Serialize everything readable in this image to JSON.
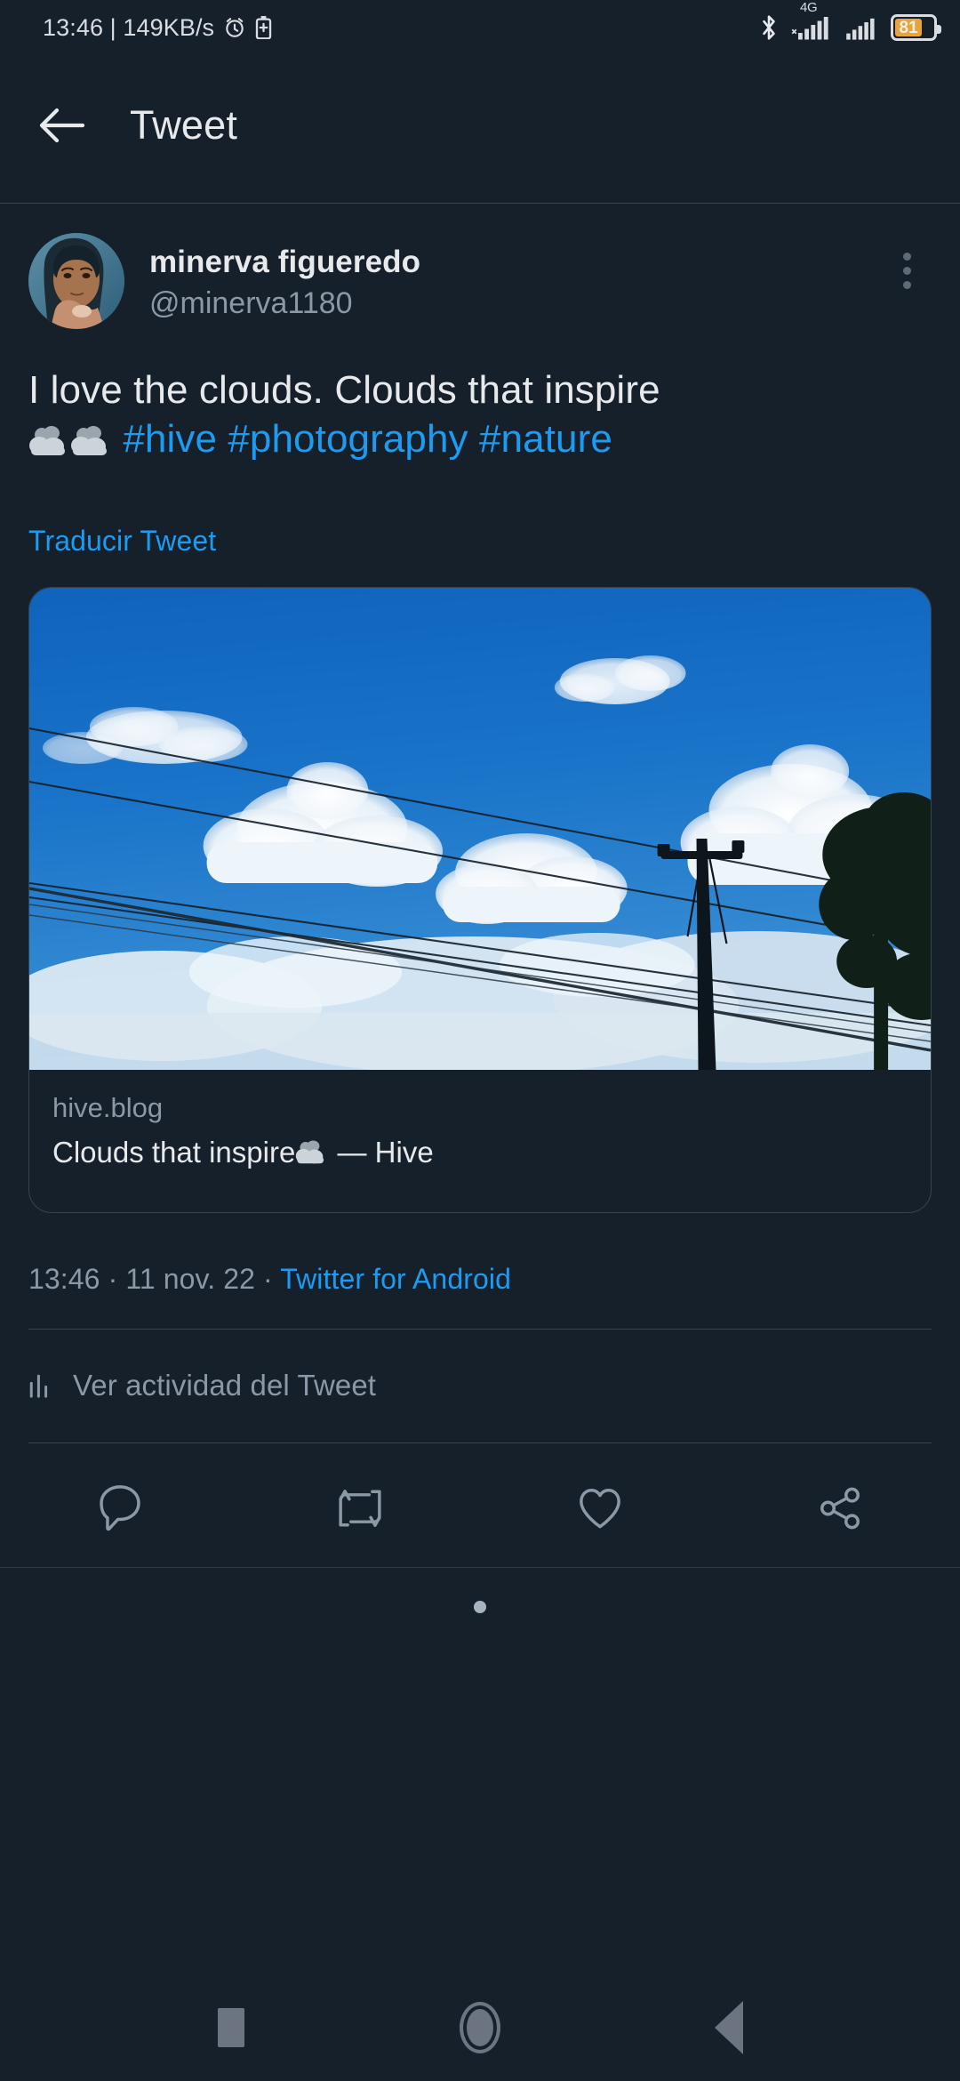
{
  "status_bar": {
    "clock_and_speed": "13:46 | 149KB/s",
    "alarm_icon": "alarm-clock-icon",
    "mini_battery_icon": "battery-saver-icon",
    "bluetooth_icon": "bluetooth-icon",
    "network_type": "4G",
    "signal_icon_1": "cellular-signal-icon",
    "signal_icon_2": "cellular-signal-icon",
    "battery_percent": "81",
    "battery_fill_color": "#e8a33d"
  },
  "header": {
    "back_icon": "back-arrow-icon",
    "title": "Tweet"
  },
  "tweet": {
    "avatar_icon": "user-avatar-image",
    "author_name": "minerva figueredo",
    "author_handle": "@minerva1180",
    "more_icon": "more-vertical-icon",
    "body_line1": "I love the clouds. Clouds that inspire",
    "cloud_emoji": "cloud-emoji",
    "hashtags": "#hive #photography #nature",
    "translate_label": "Traducir Tweet",
    "timestamp": "13:46 · 11 nov. 22 · ",
    "source_label": "Twitter for Android",
    "activity_icon": "bar-chart-icon",
    "activity_label": "Ver actividad del Tweet"
  },
  "link_card": {
    "photo_alt": "blue-sky-with-clouds-and-power-lines-photo",
    "domain": "hive.blog",
    "title_before": "Clouds that inspire",
    "title_emoji": "cloud-emoji",
    "title_after": " — Hive"
  },
  "actions": [
    {
      "name": "reply-button",
      "icon": "reply-comment-icon"
    },
    {
      "name": "retweet-button",
      "icon": "retweet-icon"
    },
    {
      "name": "like-button",
      "icon": "heart-icon"
    },
    {
      "name": "share-button",
      "icon": "share-icon"
    }
  ],
  "nav_bar": {
    "recents_icon": "recents-square-icon",
    "home_icon": "home-circle-icon",
    "back_icon": "back-triangle-icon"
  },
  "colors": {
    "background": "#15202b",
    "accent_blue": "#1d9bf0",
    "text_primary": "#e7e9ea",
    "text_secondary": "#8b98a5",
    "divider": "#38444d"
  }
}
